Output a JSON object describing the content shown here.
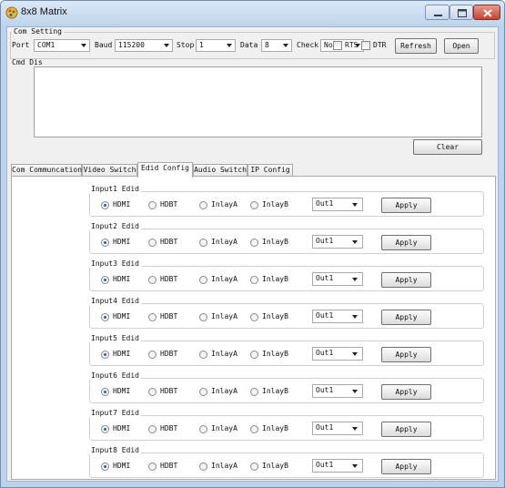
{
  "window": {
    "title": "8x8 Matrix"
  },
  "com_setting": {
    "group_label": "Com Setting",
    "port_label": "Port",
    "port_value": "COM1",
    "baud_label": "Baud",
    "baud_value": "115200",
    "stop_label": "Stop",
    "stop_value": "1",
    "data_label": "Data",
    "data_value": "8",
    "check_label": "Check",
    "check_value": "None",
    "rts_label": "RTS",
    "dtr_label": "DTR",
    "refresh_label": "Refresh",
    "open_label": "Open"
  },
  "cmd_dis": {
    "group_label": "Cmd Dis",
    "text": "",
    "clear_label": "Clear"
  },
  "tabs": [
    {
      "label": "Com Communcation"
    },
    {
      "label": "Video Switch"
    },
    {
      "label": "Edid Config"
    },
    {
      "label": "Audio Switch"
    },
    {
      "label": "IP Config"
    }
  ],
  "active_tab": "Edid Config",
  "edid": {
    "options": [
      "HDMI",
      "HDBT",
      "InlayA",
      "InlayB"
    ],
    "apply_label": "Apply",
    "rows": [
      {
        "title": "Input1 Edid",
        "selected": "HDMI",
        "output": "Out1"
      },
      {
        "title": "Input2 Edid",
        "selected": "HDMI",
        "output": "Out1"
      },
      {
        "title": "Input3 Edid",
        "selected": "HDMI",
        "output": "Out1"
      },
      {
        "title": "Input4 Edid",
        "selected": "HDMI",
        "output": "Out1"
      },
      {
        "title": "Input5 Edid",
        "selected": "HDMI",
        "output": "Out1"
      },
      {
        "title": "Input6 Edid",
        "selected": "HDMI",
        "output": "Out1"
      },
      {
        "title": "Input7 Edid",
        "selected": "HDMI",
        "output": "Out1"
      },
      {
        "title": "Input8 Edid",
        "selected": "HDMI",
        "output": "Out1"
      }
    ]
  },
  "colors": {
    "title_bar": "#c7daef",
    "close_button": "#c8412e",
    "radio_dot": "#2a5ea8"
  }
}
